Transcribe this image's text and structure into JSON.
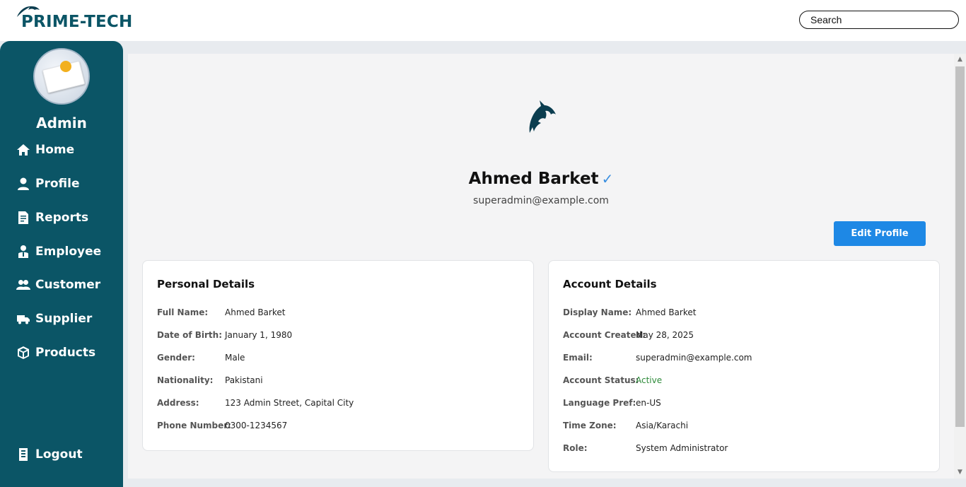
{
  "brand": {
    "name": "PRIME-TECH"
  },
  "search": {
    "placeholder": "Search"
  },
  "sidebar": {
    "role": "Admin",
    "items": [
      {
        "label": "Home",
        "icon": "home-icon"
      },
      {
        "label": "Profile",
        "icon": "user-icon"
      },
      {
        "label": "Reports",
        "icon": "report-icon"
      },
      {
        "label": "Employee",
        "icon": "employee-icon"
      },
      {
        "label": "Customer",
        "icon": "customer-icon"
      },
      {
        "label": "Supplier",
        "icon": "truck-icon"
      },
      {
        "label": "Products",
        "icon": "box-icon"
      }
    ],
    "logout": {
      "label": "Logout",
      "icon": "logout-icon"
    }
  },
  "profile": {
    "name": "Ahmed Barket",
    "verified_mark": "✓",
    "email": "superadmin@example.com",
    "edit_label": "Edit Profile"
  },
  "personal": {
    "title": "Personal Details",
    "rows": [
      {
        "k": "Full Name:",
        "v": "Ahmed Barket"
      },
      {
        "k": "Date of Birth:",
        "v": "January 1, 1980"
      },
      {
        "k": "Gender:",
        "v": "Male"
      },
      {
        "k": "Nationality:",
        "v": "Pakistani"
      },
      {
        "k": "Address:",
        "v": "123 Admin Street, Capital City"
      },
      {
        "k": "Phone Number:",
        "v": "0300-1234567"
      }
    ]
  },
  "account": {
    "title": "Account Details",
    "rows": [
      {
        "k": "Display Name:",
        "v": "Ahmed Barket"
      },
      {
        "k": "Account Created:",
        "v": "May 28, 2025"
      },
      {
        "k": "Email:",
        "v": "superadmin@example.com"
      },
      {
        "k": "Account Status:",
        "v": "Active"
      },
      {
        "k": "Language Pref:",
        "v": "en-US"
      },
      {
        "k": "Time Zone:",
        "v": "Asia/Karachi"
      },
      {
        "k": "Role:",
        "v": "System Administrator"
      }
    ]
  },
  "colors": {
    "sidebar": "#0b5566",
    "accent": "#1e88e5",
    "status_active": "#2e8b3a",
    "verified": "#3b8fe0"
  }
}
